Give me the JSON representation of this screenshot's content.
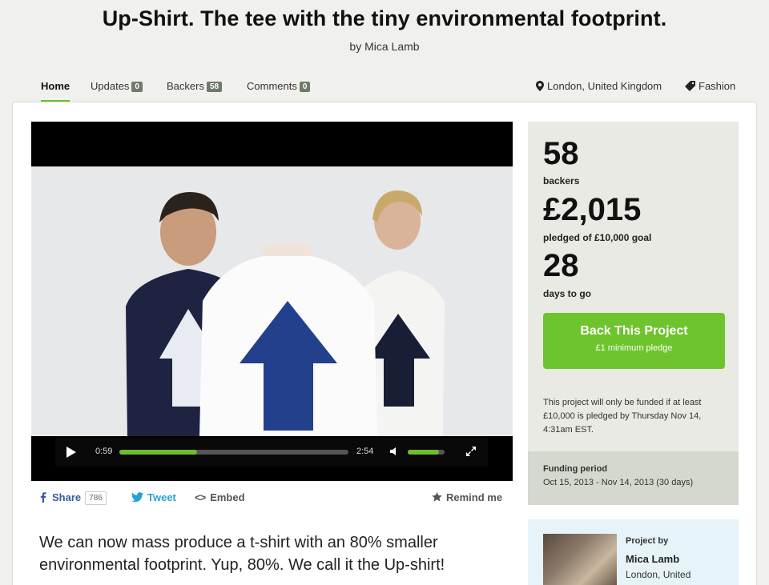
{
  "project": {
    "title": "Up-Shirt. The tee with the tiny environmental footprint.",
    "byline": "by Mica Lamb"
  },
  "tabs": [
    {
      "label": "Home",
      "count": null,
      "active": true
    },
    {
      "label": "Updates",
      "count": "0"
    },
    {
      "label": "Backers",
      "count": "58"
    },
    {
      "label": "Comments",
      "count": "0"
    }
  ],
  "meta": {
    "location": "London, United Kingdom",
    "category": "Fashion",
    "location_icon": "map-pin-icon",
    "category_icon": "tag-icon"
  },
  "video": {
    "current_time": "0:59",
    "duration": "2:54",
    "progress_fraction": 0.339,
    "volume_fraction": 0.85
  },
  "share": {
    "facebook_label": "Share",
    "facebook_count": "786",
    "tweet_label": "Tweet",
    "embed_label": "Embed",
    "remind_label": "Remind me"
  },
  "blurb": "We can now mass produce a t-shirt with an 80% smaller environmental footprint. Yup, 80%. We call it the Up-shirt!",
  "stats": {
    "backers_count": "58",
    "backers_label": "backers",
    "pledged_amount": "£2,015",
    "pledged_label": "pledged of £10,000 goal",
    "days_count": "28",
    "days_label": "days to go"
  },
  "cta": {
    "label": "Back This Project",
    "sublabel": "£1 minimum pledge"
  },
  "funding_note": "This project will only be funded if at least £10,000 is pledged by Thursday Nov 14, 4:31am EST.",
  "funding_period": {
    "heading": "Funding period",
    "value": "Oct 15, 2013 - Nov 14, 2013 (30 days)"
  },
  "creator": {
    "heading": "Project by",
    "name": "Mica Lamb",
    "location": "London, United"
  },
  "colors": {
    "accent_green": "#6ec42c",
    "facebook_blue": "#3b5998",
    "twitter_blue": "#2a9fd6"
  }
}
